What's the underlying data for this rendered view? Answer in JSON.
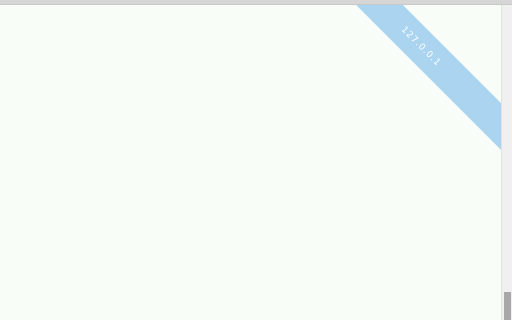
{
  "ribbon": {
    "label": "127.0.0.1",
    "color": "#aad4f0",
    "text_color": "#ffffff"
  },
  "page": {
    "background": "#f8fdf8"
  },
  "scrollbar": {
    "position_fraction": 1.0
  }
}
